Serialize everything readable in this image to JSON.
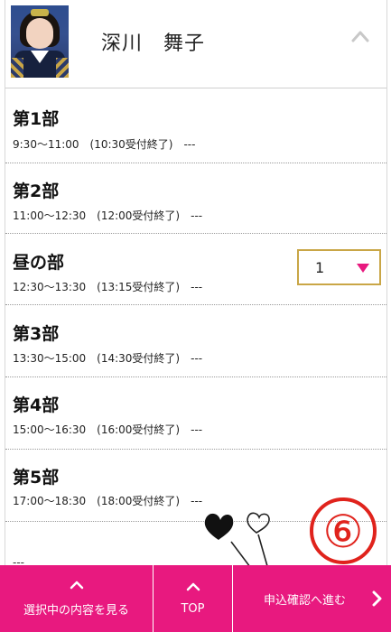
{
  "member": {
    "name": "深川　舞子",
    "avatar": "member-photo"
  },
  "sessions": [
    {
      "title": "第1部",
      "time": "9:30～11:00　(10:30受付終了)　---"
    },
    {
      "title": "第2部",
      "time": "11:00～12:30　(12:00受付終了)　---"
    },
    {
      "title": "昼の部",
      "time": "12:30～13:30　(13:15受付終了)　---",
      "quantity": "1"
    },
    {
      "title": "第3部",
      "time": "13:30～15:00　(14:30受付終了)　---"
    },
    {
      "title": "第4部",
      "time": "15:00～16:30　(16:00受付終了)　---"
    },
    {
      "title": "第5部",
      "time": "17:00～18:30　(18:00受付終了)　---"
    }
  ],
  "partial_row_text": "---",
  "annotation": {
    "step": "⑥"
  },
  "bottom_bar": {
    "view_selection_label": "選択中の内容を見る",
    "top_label": "TOP",
    "proceed_label": "申込確認へ進む"
  },
  "colors": {
    "accent": "#e8197f",
    "select_border": "#c9a646",
    "annotation_red": "#e0231c"
  },
  "icons": {
    "collapse": "chevron-up-icon",
    "dropdown": "triangle-down-icon",
    "proceed": "chevron-right-icon"
  }
}
